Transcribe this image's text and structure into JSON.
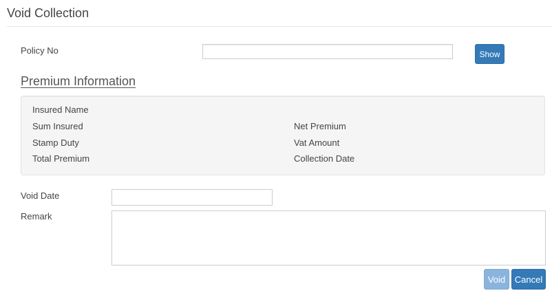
{
  "page": {
    "title": "Void Collection"
  },
  "policy": {
    "label": "Policy No",
    "value": "",
    "show_label": "Show"
  },
  "premium_info": {
    "heading": "Premium Information",
    "insured_name_label": "Insured Name",
    "sum_insured_label": "Sum Insured",
    "net_premium_label": "Net Premium",
    "stamp_duty_label": "Stamp Duty",
    "vat_amount_label": "Vat Amount",
    "total_premium_label": "Total Premium",
    "collection_date_label": "Collection Date"
  },
  "void_form": {
    "void_date_label": "Void Date",
    "void_date_value": "",
    "remark_label": "Remark",
    "remark_value": "",
    "void_label": "Void",
    "cancel_label": "Cancel"
  },
  "colors": {
    "primary": "#337ab7",
    "primary_disabled": "#8ab4dd",
    "panel_bg": "#f5f5f5"
  }
}
